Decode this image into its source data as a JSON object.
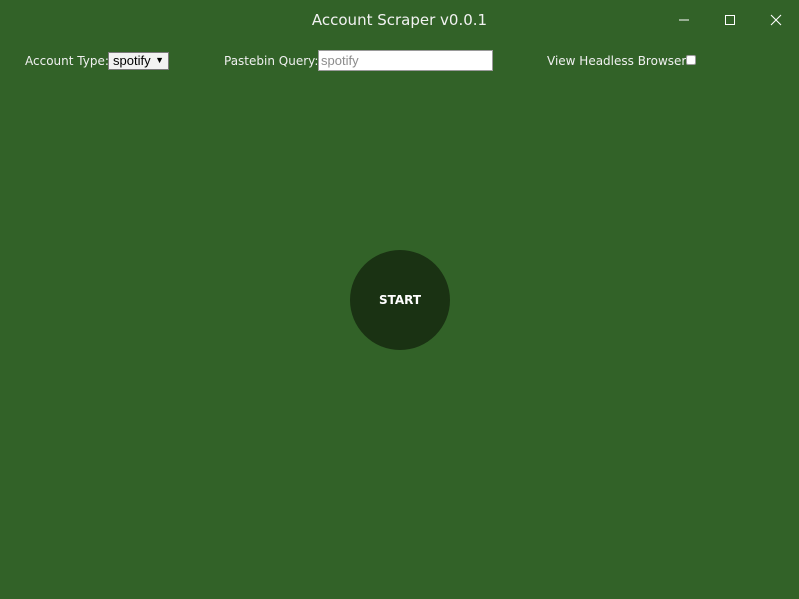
{
  "window": {
    "title": "Account Scraper v0.0.1"
  },
  "controls": {
    "account_type_label": "Account Type:",
    "account_type_value": "spotify",
    "pastebin_query_label": "Pastebin Query:",
    "pastebin_query_placeholder": "spotify",
    "headless_label": "View Headless Browser?",
    "headless_checked": false
  },
  "main": {
    "start_label": "START"
  },
  "colors": {
    "background": "#326228",
    "start_button": "#1a3213",
    "text": "#ffffff"
  },
  "icons": {
    "minimize": "minimize-icon",
    "maximize": "maximize-icon",
    "close": "close-icon",
    "dropdown": "dropdown-arrow-icon"
  }
}
